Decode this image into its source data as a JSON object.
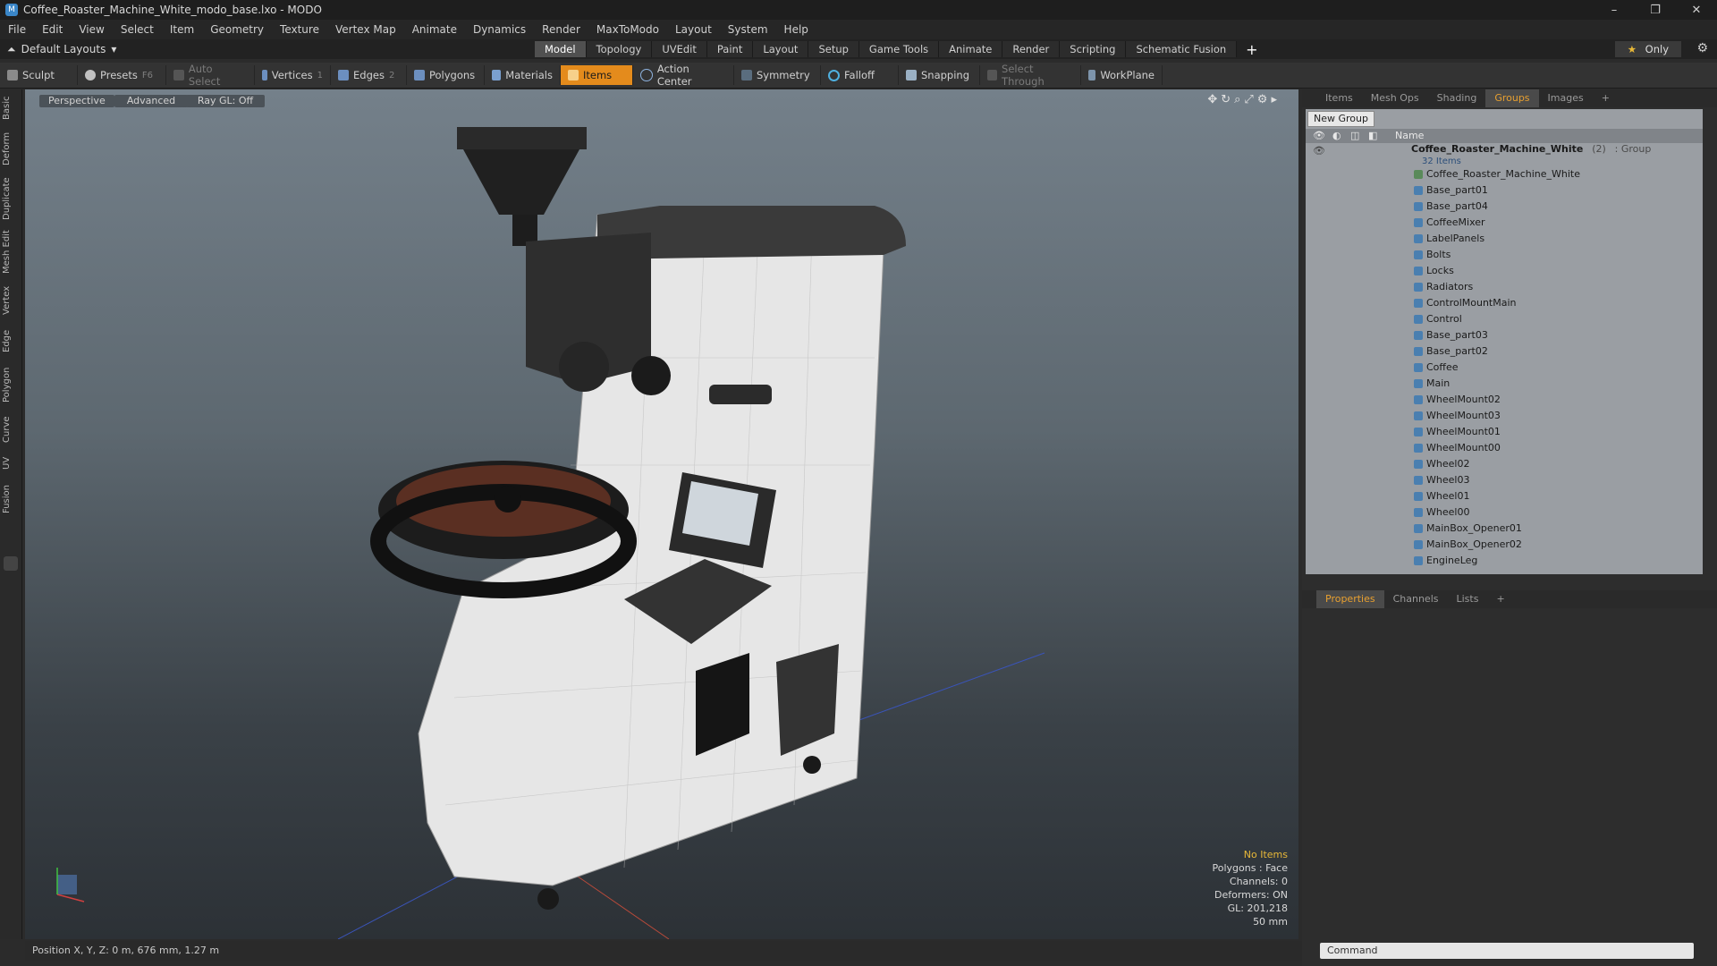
{
  "window": {
    "title": "Coffee_Roaster_Machine_White_modo_base.lxo - MODO",
    "min": "–",
    "restore": "❐",
    "close": "✕"
  },
  "menu": [
    "File",
    "Edit",
    "View",
    "Select",
    "Item",
    "Geometry",
    "Texture",
    "Vertex Map",
    "Animate",
    "Dynamics",
    "Render",
    "MaxToModo",
    "Layout",
    "System",
    "Help"
  ],
  "layouts_label": "Default Layouts",
  "layout_tabs": [
    "Model",
    "Topology",
    "UVEdit",
    "Paint",
    "Layout",
    "Setup",
    "Game Tools",
    "Animate",
    "Render",
    "Scripting",
    "Schematic Fusion"
  ],
  "only_label": "Only",
  "toolbar": {
    "sculpt": "Sculpt",
    "presets": "Presets",
    "presets_key": "F6",
    "auto_select": "Auto Select",
    "vertices": "Vertices",
    "vertices_key": "1",
    "edges": "Edges",
    "edges_key": "2",
    "polygons": "Polygons",
    "materials": "Materials",
    "items": "Items",
    "action_center": "Action Center",
    "symmetry": "Symmetry",
    "falloff": "Falloff",
    "snapping": "Snapping",
    "select_through": "Select Through",
    "workplane": "WorkPlane"
  },
  "left_tabs": [
    "Basic",
    "Deform",
    "Duplicate",
    "Mesh Edit",
    "Vertex",
    "Edge",
    "Polygon",
    "Curve",
    "UV",
    "Fusion"
  ],
  "viewport": {
    "perspective": "Perspective",
    "advanced": "Advanced",
    "raygl": "Ray GL: Off",
    "info": {
      "no_items": "No Items",
      "polygons": "Polygons : Face",
      "channels": "Channels: 0",
      "deformers": "Deformers: ON",
      "gl": "GL: 201,218",
      "scale": "50 mm"
    }
  },
  "status": "Position X, Y, Z:  0 m, 676 mm, 1.27 m",
  "panel_tabs": [
    "Items",
    "Mesh Ops",
    "Shading",
    "Groups",
    "Images"
  ],
  "groups": {
    "new_group": "New Group",
    "col_name": "Name",
    "root": {
      "label": "Coffee_Roaster_Machine_White",
      "count": "(2)",
      "kind": ": Group",
      "items": "32 Items"
    },
    "items": [
      "Coffee_Roaster_Machine_White",
      "Base_part01",
      "Base_part04",
      "CoffeeMixer",
      "LabelPanels",
      "Bolts",
      "Locks",
      "Radiators",
      "ControlMountMain",
      "Control",
      "Base_part03",
      "Base_part02",
      "Coffee",
      "Main",
      "WheelMount02",
      "WheelMount03",
      "WheelMount01",
      "WheelMount00",
      "Wheel02",
      "Wheel03",
      "Wheel01",
      "Wheel00",
      "MainBox_Opener01",
      "MainBox_Opener02",
      "EngineLeg"
    ]
  },
  "prop_tabs": [
    "Properties",
    "Channels",
    "Lists"
  ],
  "command_placeholder": "Command",
  "colors": {
    "accent": "#e48b1c",
    "active_tab": "#e8a030",
    "info_highlight": "#e8b838"
  }
}
